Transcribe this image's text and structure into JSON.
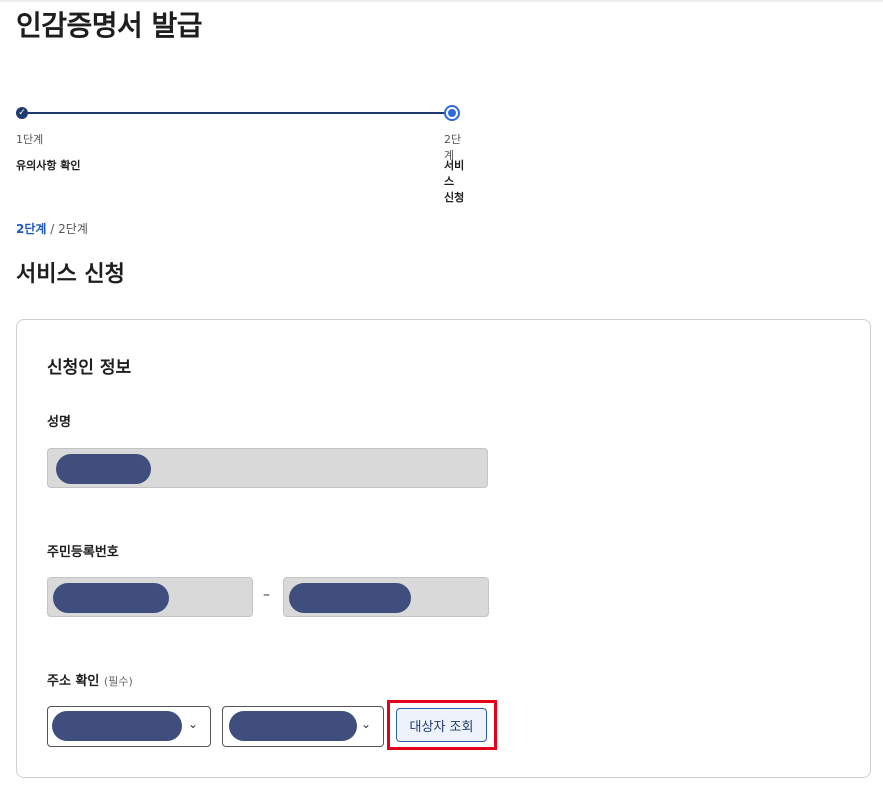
{
  "page": {
    "title": "인감증명서 발급"
  },
  "stepper": {
    "steps": [
      {
        "number_label": "1단계",
        "name": "유의사항 확인",
        "status": "done"
      },
      {
        "number_label": "2단계",
        "name": "서비스 신청",
        "status": "current"
      }
    ],
    "done_icon": "check-icon"
  },
  "breadcrumb": {
    "current": "2단계",
    "separator": "/",
    "total": "2단계"
  },
  "section": {
    "title": "서비스 신청"
  },
  "applicant": {
    "title": "신청인 정보",
    "name_label": "성명",
    "rrn_label": "주민등록번호",
    "rrn_separator": "–",
    "address_label": "주소 확인",
    "address_hint": "(필수)",
    "lookup_button": "대상자 조회",
    "chevron": "⌄"
  },
  "colors": {
    "accent": "#1f3a6e",
    "current_step": "#2f6bd8",
    "highlight": "#e3001b",
    "mask": "#3f4e7c",
    "disabled_bg": "#d9d9d9"
  }
}
